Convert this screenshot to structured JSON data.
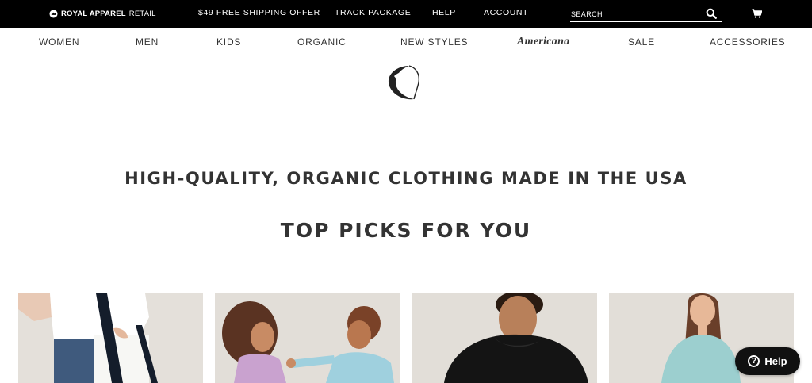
{
  "topbar": {
    "logo": {
      "brand": "ROYAL APPAREL",
      "suffix": "RETAIL"
    },
    "links": [
      "$49 FREE SHIPPING OFFER",
      "TRACK PACKAGE",
      "HELP",
      "ACCOUNT"
    ],
    "search": {
      "placeholder": "SEARCH",
      "value": ""
    },
    "cart_icon": "cart-icon"
  },
  "catnav": {
    "items": [
      "WOMEN",
      "MEN",
      "KIDS",
      "ORGANIC",
      "NEW STYLES",
      "Americana",
      "SALE",
      "ACCESSORIES"
    ]
  },
  "hero": {
    "tagline": "HIGH-QUALITY, ORGANIC CLOTHING MADE IN THE USA",
    "section_title": "TOP PICKS FOR YOU"
  },
  "products": [
    {
      "alt": "tote bag"
    },
    {
      "alt": "kids"
    },
    {
      "alt": "hoodie"
    },
    {
      "alt": "sweatshirt"
    }
  ],
  "help_widget": {
    "label": "Help",
    "icon": "?"
  },
  "colors": {
    "topbar_bg": "#000000",
    "text": "#333333",
    "tile_bg": "#e2ded8"
  }
}
